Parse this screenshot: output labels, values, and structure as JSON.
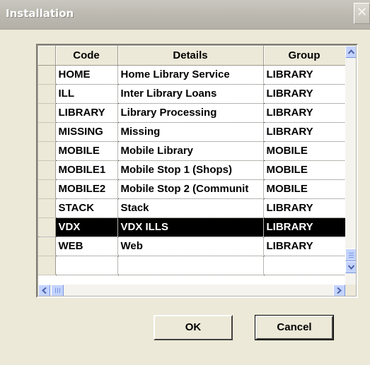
{
  "window": {
    "title": "Installation",
    "close_glyph": "✕"
  },
  "grid": {
    "columns": [
      "Code",
      "Details",
      "Group"
    ],
    "rows": [
      {
        "code": "HOME",
        "details": "Home Library Service",
        "group": "LIBRARY"
      },
      {
        "code": "ILL",
        "details": "Inter Library Loans",
        "group": "LIBRARY"
      },
      {
        "code": "LIBRARY",
        "details": "Library Processing",
        "group": "LIBRARY"
      },
      {
        "code": "MISSING",
        "details": "Missing",
        "group": "LIBRARY"
      },
      {
        "code": "MOBILE",
        "details": "Mobile Library",
        "group": "MOBILE"
      },
      {
        "code": "MOBILE1",
        "details": "Mobile Stop 1 (Shops)",
        "group": "MOBILE"
      },
      {
        "code": "MOBILE2",
        "details": "Mobile Stop 2 (Communit",
        "group": "MOBILE"
      },
      {
        "code": "STACK",
        "details": "Stack",
        "group": "LIBRARY"
      },
      {
        "code": "VDX",
        "details": "VDX ILLS",
        "group": "LIBRARY"
      },
      {
        "code": "WEB",
        "details": "Web",
        "group": "LIBRARY"
      },
      {
        "code": "",
        "details": "",
        "group": ""
      }
    ],
    "selected_row_index": 8
  },
  "buttons": {
    "ok": "OK",
    "cancel": "Cancel"
  },
  "colors": {
    "selection_bg": "#000000",
    "selection_fg": "#ffffff",
    "scroll_button": "#c3d3fd"
  }
}
